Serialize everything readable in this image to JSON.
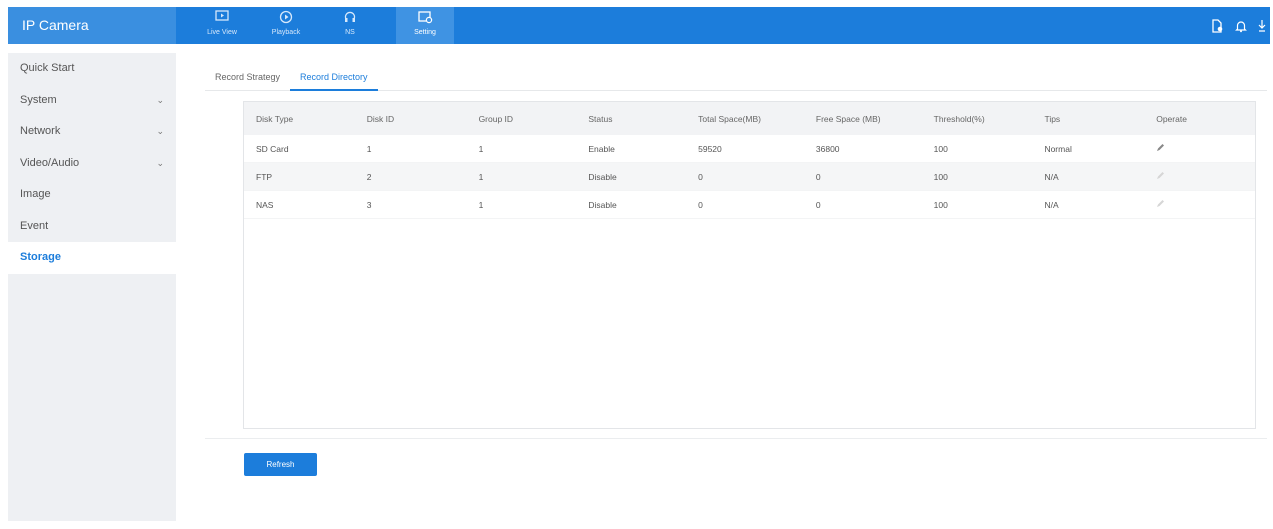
{
  "app": {
    "title": "IP Camera"
  },
  "nav": [
    {
      "label": "Live View",
      "icon": "live-view-icon"
    },
    {
      "label": "Playback",
      "icon": "playback-icon"
    },
    {
      "label": "NS",
      "icon": "ns-icon"
    },
    {
      "label": "Setting",
      "icon": "setting-icon",
      "active": true
    }
  ],
  "sidebar": {
    "items": [
      {
        "label": "Quick Start",
        "expandable": false
      },
      {
        "label": "System",
        "expandable": true
      },
      {
        "label": "Network",
        "expandable": true
      },
      {
        "label": "Video/Audio",
        "expandable": true
      },
      {
        "label": "Image",
        "expandable": false
      },
      {
        "label": "Event",
        "expandable": false
      },
      {
        "label": "Storage",
        "expandable": false,
        "active": true
      }
    ]
  },
  "tabs": [
    {
      "label": "Record Strategy"
    },
    {
      "label": "Record Directory",
      "active": true
    }
  ],
  "table": {
    "headers": [
      "Disk Type",
      "Disk ID",
      "Group ID",
      "Status",
      "Total Space(MB)",
      "Free Space (MB)",
      "Threshold(%)",
      "Tips",
      "Operate"
    ],
    "rows": [
      [
        "SD Card",
        "1",
        "1",
        "Enable",
        "59520",
        "36800",
        "100",
        "Normal"
      ],
      [
        "FTP",
        "2",
        "1",
        "Disable",
        "0",
        "0",
        "100",
        "N/A"
      ],
      [
        "NAS",
        "3",
        "1",
        "Disable",
        "0",
        "0",
        "100",
        "N/A"
      ]
    ]
  },
  "actions": {
    "refresh_label": "Refresh"
  },
  "colors": {
    "primary": "#1c7ddb",
    "sidebar_bg": "#eef0f3"
  }
}
